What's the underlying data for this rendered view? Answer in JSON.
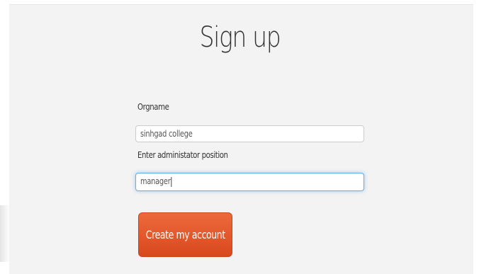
{
  "form": {
    "title": "Sign up",
    "org_label": "Orgname",
    "org_value": "sinhgad college",
    "position_label": "Enter administator position",
    "position_value": "manager",
    "submit_label": "Create my account"
  },
  "colors": {
    "panel_background": "#f3f3f3",
    "button_background": "#e05325",
    "focus_border": "#66afe9"
  }
}
